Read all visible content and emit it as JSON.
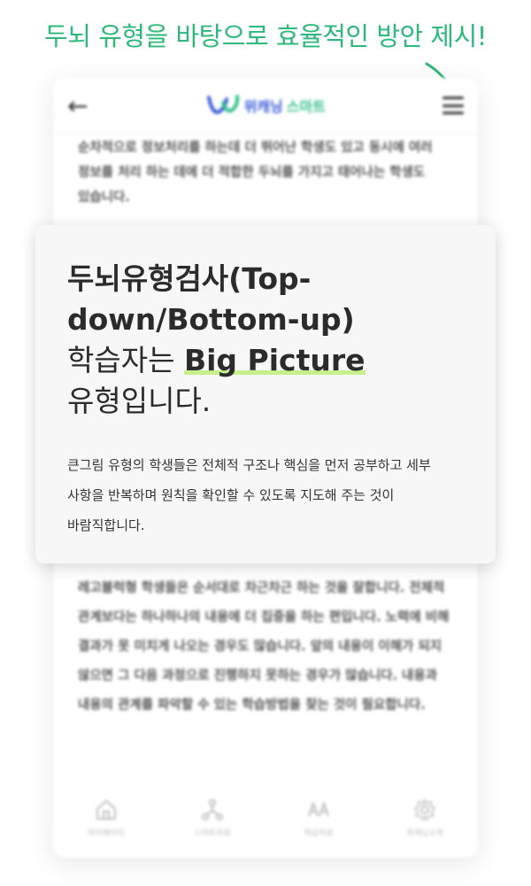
{
  "headline": "두뇌 유형을 바탕으로 효율적인 방안 제시!",
  "phone": {
    "logo_text_a": "위캐닝",
    "logo_text_b": "스마트",
    "top_text": "순차적으로 정보처리를 하는데 더 뛰어난 학생도 있고 동시에 여러 정보를 처리 하는 데에 더 적합한 두뇌를 가지고 태어나는 학생도 있습니다.",
    "bottom_text": "레고블럭형 학생들은 순서대로 차근차근 하는 것을 잘합니다. 전체적 관계보다는 하나하나의 내용에 더 집중을 하는 편입니다. 노력에 비해 결과가 못 미치게 나오는 경우도 많습니다. 앞의 내용이 이해가 되지 않으면 그 다음 과정으로 진행하지 못하는 경우가 많습니다. 내용과 내용의 관계를 파악할 수 있는 학습방법을 찾는 것이 필요합니다.",
    "tabs": [
      {
        "icon": "home-icon",
        "label": "마이페이지"
      },
      {
        "icon": "network-icon",
        "label": "스마트자료"
      },
      {
        "icon": "font-icon",
        "label": "학습자료"
      },
      {
        "icon": "settings-icon",
        "label": "위캐닝소개"
      }
    ]
  },
  "card": {
    "title": "두뇌유형검사(Top-down/Bottom-up)",
    "subtitle_prefix": "학습자는 ",
    "subtitle_highlight": "Big Picture",
    "subtitle_suffix": "유형입니다.",
    "body": "큰그림 유형의 학생들은 전체적 구조나 핵심을 먼저 공부하고 세부 사항을 반복하며 원칙을 확인할 수 있도록 지도해 주는 것이 바람직합니다."
  },
  "colors": {
    "accent_green": "#2cb97a",
    "highlight_green": "#c6f08a",
    "logo_blue": "#3a5bd9"
  }
}
